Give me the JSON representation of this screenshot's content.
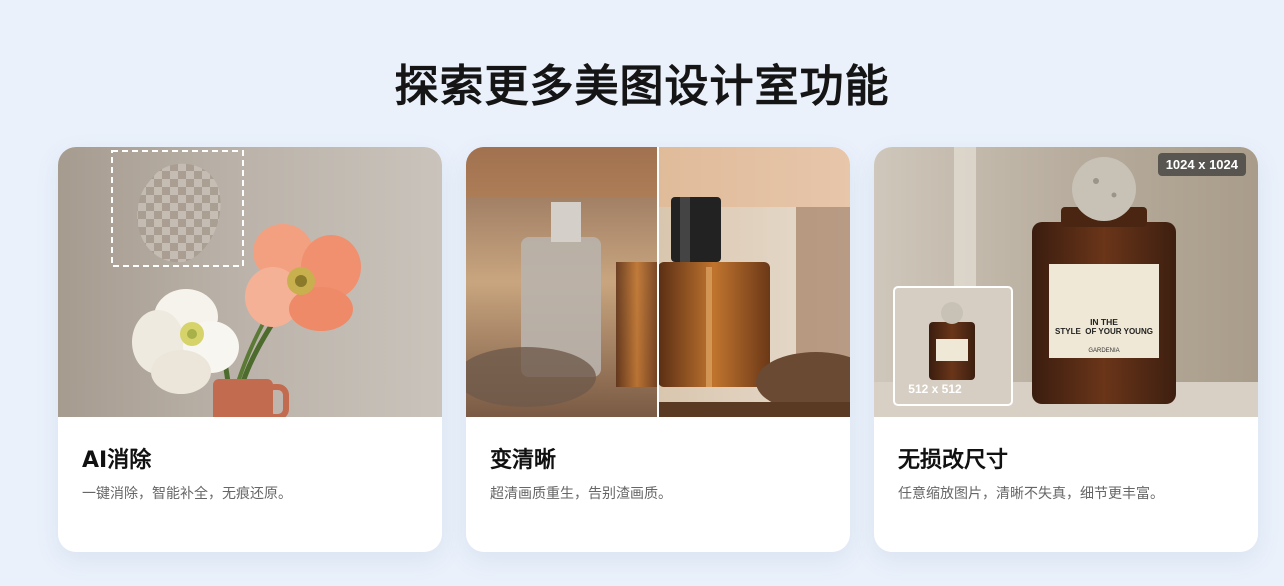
{
  "page": {
    "title": "探索更多美图设计室功能"
  },
  "cards": [
    {
      "title": "AI消除",
      "description": "一键消除，智能补全，无痕还原。"
    },
    {
      "title": "变清晰",
      "description": "超清画质重生，告别渣画质。"
    },
    {
      "title": "无损改尺寸",
      "description": "任意缩放图片，清晰不失真，细节更丰富。",
      "badge": "1024 x 1024",
      "thumb_badge": "512 x 512",
      "label_line1": "IN THE",
      "label_line2": "STYLE  OF YOUR YOUNG",
      "label_brand": "GARDENIA"
    }
  ],
  "colors": {
    "background": "#eaf1fb",
    "card": "#ffffff",
    "title": "#151515",
    "description": "#666666"
  }
}
